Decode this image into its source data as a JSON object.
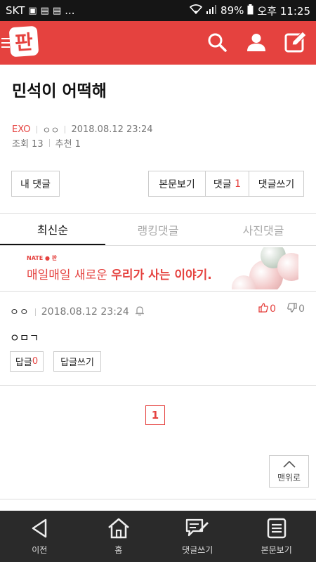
{
  "status_bar": {
    "carrier": "SKT",
    "notif_text": "...",
    "battery": "89%",
    "time": "오후 11:25"
  },
  "header": {
    "logo": "판",
    "icons": [
      "menu-icon",
      "search-icon",
      "user-icon",
      "edit-icon"
    ]
  },
  "article": {
    "title": "민석이 어떡해",
    "category": "EXO",
    "author": "ㅇㅇ",
    "date": "2018.08.12 23:24",
    "views": "조회 13",
    "recommends": "추천 1"
  },
  "actions": {
    "my_comments": "내 댓글",
    "view_body": "본문보기",
    "comments_label": "댓글",
    "comments_count": "1",
    "write_comment": "댓글쓰기"
  },
  "tabs": [
    "최신순",
    "랭킹댓글",
    "사진댓글"
  ],
  "banner": {
    "tag": "NATE ● 판",
    "text_plain": "매일매일 새로운",
    "text_bold": "우리가 사는 이야기."
  },
  "comment": {
    "author": "ㅇㅇ",
    "date": "2018.08.12 23:24",
    "likes": "0",
    "dislikes": "0",
    "body": "ㅇㅁㄱ",
    "reply_label": "답글",
    "reply_count": "0",
    "write_reply": "답글쓰기"
  },
  "pagination": {
    "current": "1"
  },
  "to_top": "맨위로",
  "bottom_nav": [
    {
      "label": "이전",
      "icon": "back-icon"
    },
    {
      "label": "홈",
      "icon": "home-icon"
    },
    {
      "label": "댓글쓰기",
      "icon": "comment-write-icon"
    },
    {
      "label": "본문보기",
      "icon": "document-icon"
    }
  ],
  "colors": {
    "brand": "#e5423f",
    "status_bar": "#151515",
    "bottom_nav": "#2a2a2a"
  }
}
